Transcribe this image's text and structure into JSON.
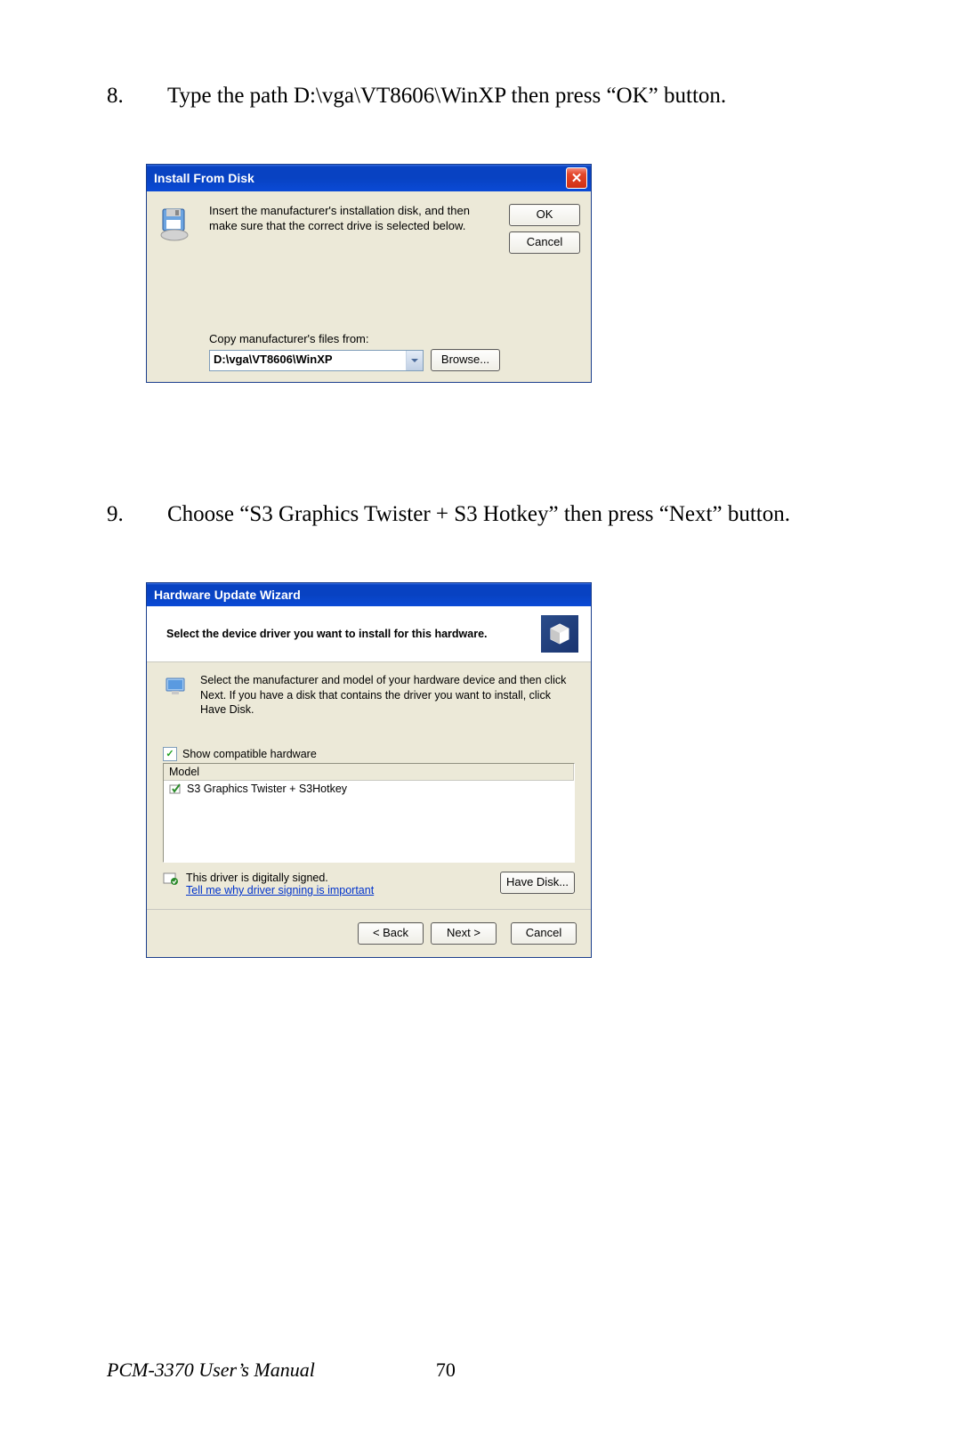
{
  "instructions": {
    "step8": {
      "num": "8.",
      "text": "Type the path D:\\vga\\VT8606\\WinXP  then press “OK” button."
    },
    "step9": {
      "num": "9.",
      "text": "Choose “S3 Graphics Twister + S3 Hotkey” then press “Next” button."
    }
  },
  "dialog1": {
    "title": "Install From Disk",
    "message": "Insert the manufacturer's installation disk, and then make sure that the correct drive is selected below.",
    "ok": "OK",
    "cancel": "Cancel",
    "copy_label": "Copy manufacturer's files from:",
    "path": "D:\\vga\\VT8606\\WinXP",
    "browse": "Browse..."
  },
  "dialog2": {
    "title": "Hardware Update Wizard",
    "heading": "Select the device driver you want to install for this hardware.",
    "select_text": "Select the manufacturer and model of your hardware device and then click Next. If you have a disk that contains the driver you want to install, click Have Disk.",
    "show_compat": "Show compatible hardware",
    "model_header": "Model",
    "model_item": "S3 Graphics Twister + S3Hotkey",
    "signed_text": "This driver is digitally signed.",
    "signed_link": "Tell me why driver signing is important",
    "have_disk": "Have Disk...",
    "back": "< Back",
    "next": "Next >",
    "cancel": "Cancel"
  },
  "footer": {
    "title": "PCM-3370 User’s Manual",
    "page": "70"
  }
}
